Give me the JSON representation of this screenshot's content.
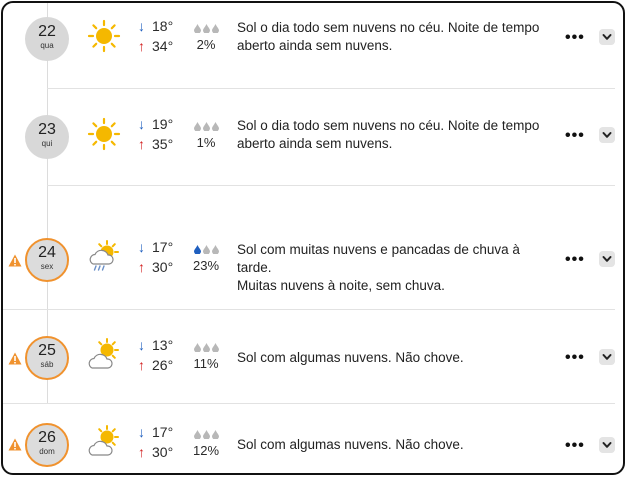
{
  "days": [
    {
      "num": "22",
      "weekday": "qua",
      "alert": false,
      "icon": "sun-icon",
      "min": "18°",
      "max": "34°",
      "rain": "2%",
      "rain_level": 0,
      "desc": [
        "Sol o dia todo sem nuvens no céu. Noite de tempo",
        "aberto ainda sem nuvens."
      ]
    },
    {
      "num": "23",
      "weekday": "qui",
      "alert": false,
      "icon": "sun-icon",
      "min": "19°",
      "max": "35°",
      "rain": "1%",
      "rain_level": 0,
      "desc": [
        "Sol o dia todo sem nuvens no céu. Noite de tempo",
        "aberto ainda sem nuvens."
      ]
    },
    {
      "num": "24",
      "weekday": "sex",
      "alert": true,
      "icon": "sun-cloud-rain-icon",
      "min": "17°",
      "max": "30°",
      "rain": "23%",
      "rain_level": 1,
      "desc": [
        "Sol com muitas nuvens e pancadas de chuva à tarde.",
        "Muitas nuvens à noite, sem chuva."
      ]
    },
    {
      "num": "25",
      "weekday": "sáb",
      "alert": true,
      "icon": "sun-cloud-icon",
      "min": "13°",
      "max": "26°",
      "rain": "11%",
      "rain_level": 0,
      "desc": [
        "Sol com algumas nuvens. Não chove."
      ]
    },
    {
      "num": "26",
      "weekday": "dom",
      "alert": true,
      "icon": "sun-cloud-icon",
      "min": "17°",
      "max": "30°",
      "rain": "12%",
      "rain_level": 0,
      "desc": [
        "Sol com algumas nuvens. Não chove."
      ]
    }
  ],
  "colors": {
    "alert": "#f0922e",
    "min_arrow": "#1f5fbf",
    "max_arrow": "#d32020",
    "sun": "#f5b800",
    "drop_on": "#1f5fbf",
    "drop_off": "#b8b8b8"
  },
  "more_label": "•••"
}
